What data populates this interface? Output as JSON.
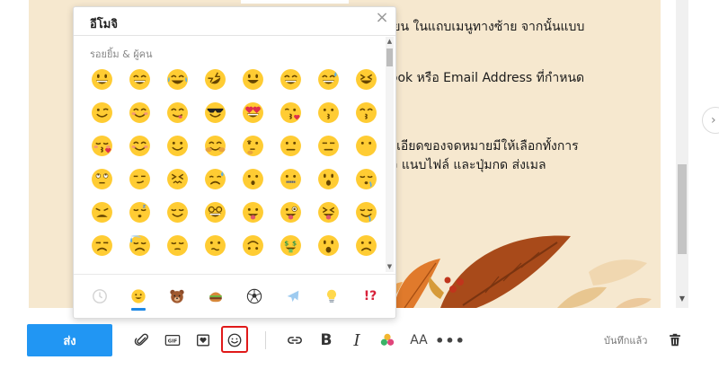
{
  "email_body": {
    "line1": "เรียน ในแถบเมนูทางซ้าย จากนั้นแบบ",
    "line2": "book หรือ Email Address ที่กำหนด",
    "line3": "ละเอียดของจดหมายมีให้เลือกทั้งการ",
    "line4": "มจิ แนบไฟล์ และปุ่มกด ส่งเมล"
  },
  "emoji_picker": {
    "title": "อีโมจิ",
    "category_label": "รอยยิ้ม & ผู้คน",
    "close_label": "×",
    "emojis": [
      {
        "name": "grinning-face"
      },
      {
        "name": "beaming-face"
      },
      {
        "name": "tears-of-joy"
      },
      {
        "name": "rolling-on-floor-laughing"
      },
      {
        "name": "smiley-face"
      },
      {
        "name": "grinning-smiling-eyes"
      },
      {
        "name": "grinning-sweat"
      },
      {
        "name": "squinting-face"
      },
      {
        "name": "winking-face"
      },
      {
        "name": "smiling-eyes"
      },
      {
        "name": "savoring-food"
      },
      {
        "name": "sunglasses-face"
      },
      {
        "name": "heart-eyes"
      },
      {
        "name": "face-blowing-kiss"
      },
      {
        "name": "kissing-face"
      },
      {
        "name": "kissing-smiling-eyes"
      },
      {
        "name": "kissing-closed-eyes"
      },
      {
        "name": "smiling-blush"
      },
      {
        "name": "slightly-smiling"
      },
      {
        "name": "hugging-face"
      },
      {
        "name": "thinking-face"
      },
      {
        "name": "neutral-face"
      },
      {
        "name": "expressionless-face"
      },
      {
        "name": "no-mouth-face"
      },
      {
        "name": "eye-roll"
      },
      {
        "name": "smirking-face"
      },
      {
        "name": "persevering-face"
      },
      {
        "name": "disappointed-relieved"
      },
      {
        "name": "hushed-face"
      },
      {
        "name": "zipper-mouth"
      },
      {
        "name": "astonished-face"
      },
      {
        "name": "sleepy-face"
      },
      {
        "name": "tired-face"
      },
      {
        "name": "sleeping-face"
      },
      {
        "name": "relieved-face"
      },
      {
        "name": "nerd-face"
      },
      {
        "name": "tongue-out"
      },
      {
        "name": "winking-tongue"
      },
      {
        "name": "squinting-tongue"
      },
      {
        "name": "drooling-face"
      },
      {
        "name": "unamused-face"
      },
      {
        "name": "downcast-sweat"
      },
      {
        "name": "pensive-face"
      },
      {
        "name": "confused-face"
      },
      {
        "name": "upside-down-face"
      },
      {
        "name": "money-mouth"
      },
      {
        "name": "astonished-open"
      },
      {
        "name": "frowning-face"
      }
    ],
    "categories": [
      {
        "name": "recent",
        "icon": "clock-icon"
      },
      {
        "name": "smileys-people",
        "icon": "smiley-icon",
        "active": true
      },
      {
        "name": "animals-nature",
        "icon": "bear-icon"
      },
      {
        "name": "food-drink",
        "icon": "burger-icon"
      },
      {
        "name": "activity",
        "icon": "soccer-ball-icon"
      },
      {
        "name": "travel-places",
        "icon": "airplane-icon"
      },
      {
        "name": "objects",
        "icon": "lightbulb-icon"
      },
      {
        "name": "symbols",
        "icon": "symbols-icon",
        "label": "!?"
      }
    ]
  },
  "toolbar": {
    "send_label": "ส่ง",
    "gif_label": "GIF",
    "saved_label": "บันทึกแล้ว",
    "bold_label": "B",
    "italic_label": "I",
    "text_size_label": "AA",
    "more_label": "•••"
  },
  "colors": {
    "compose_background": "#f6e8cf",
    "send_button": "#2196f3",
    "emoji_yellow": "#ffcc33",
    "highlight_red": "#e01919",
    "active_tab_underline": "#1e88e5"
  }
}
